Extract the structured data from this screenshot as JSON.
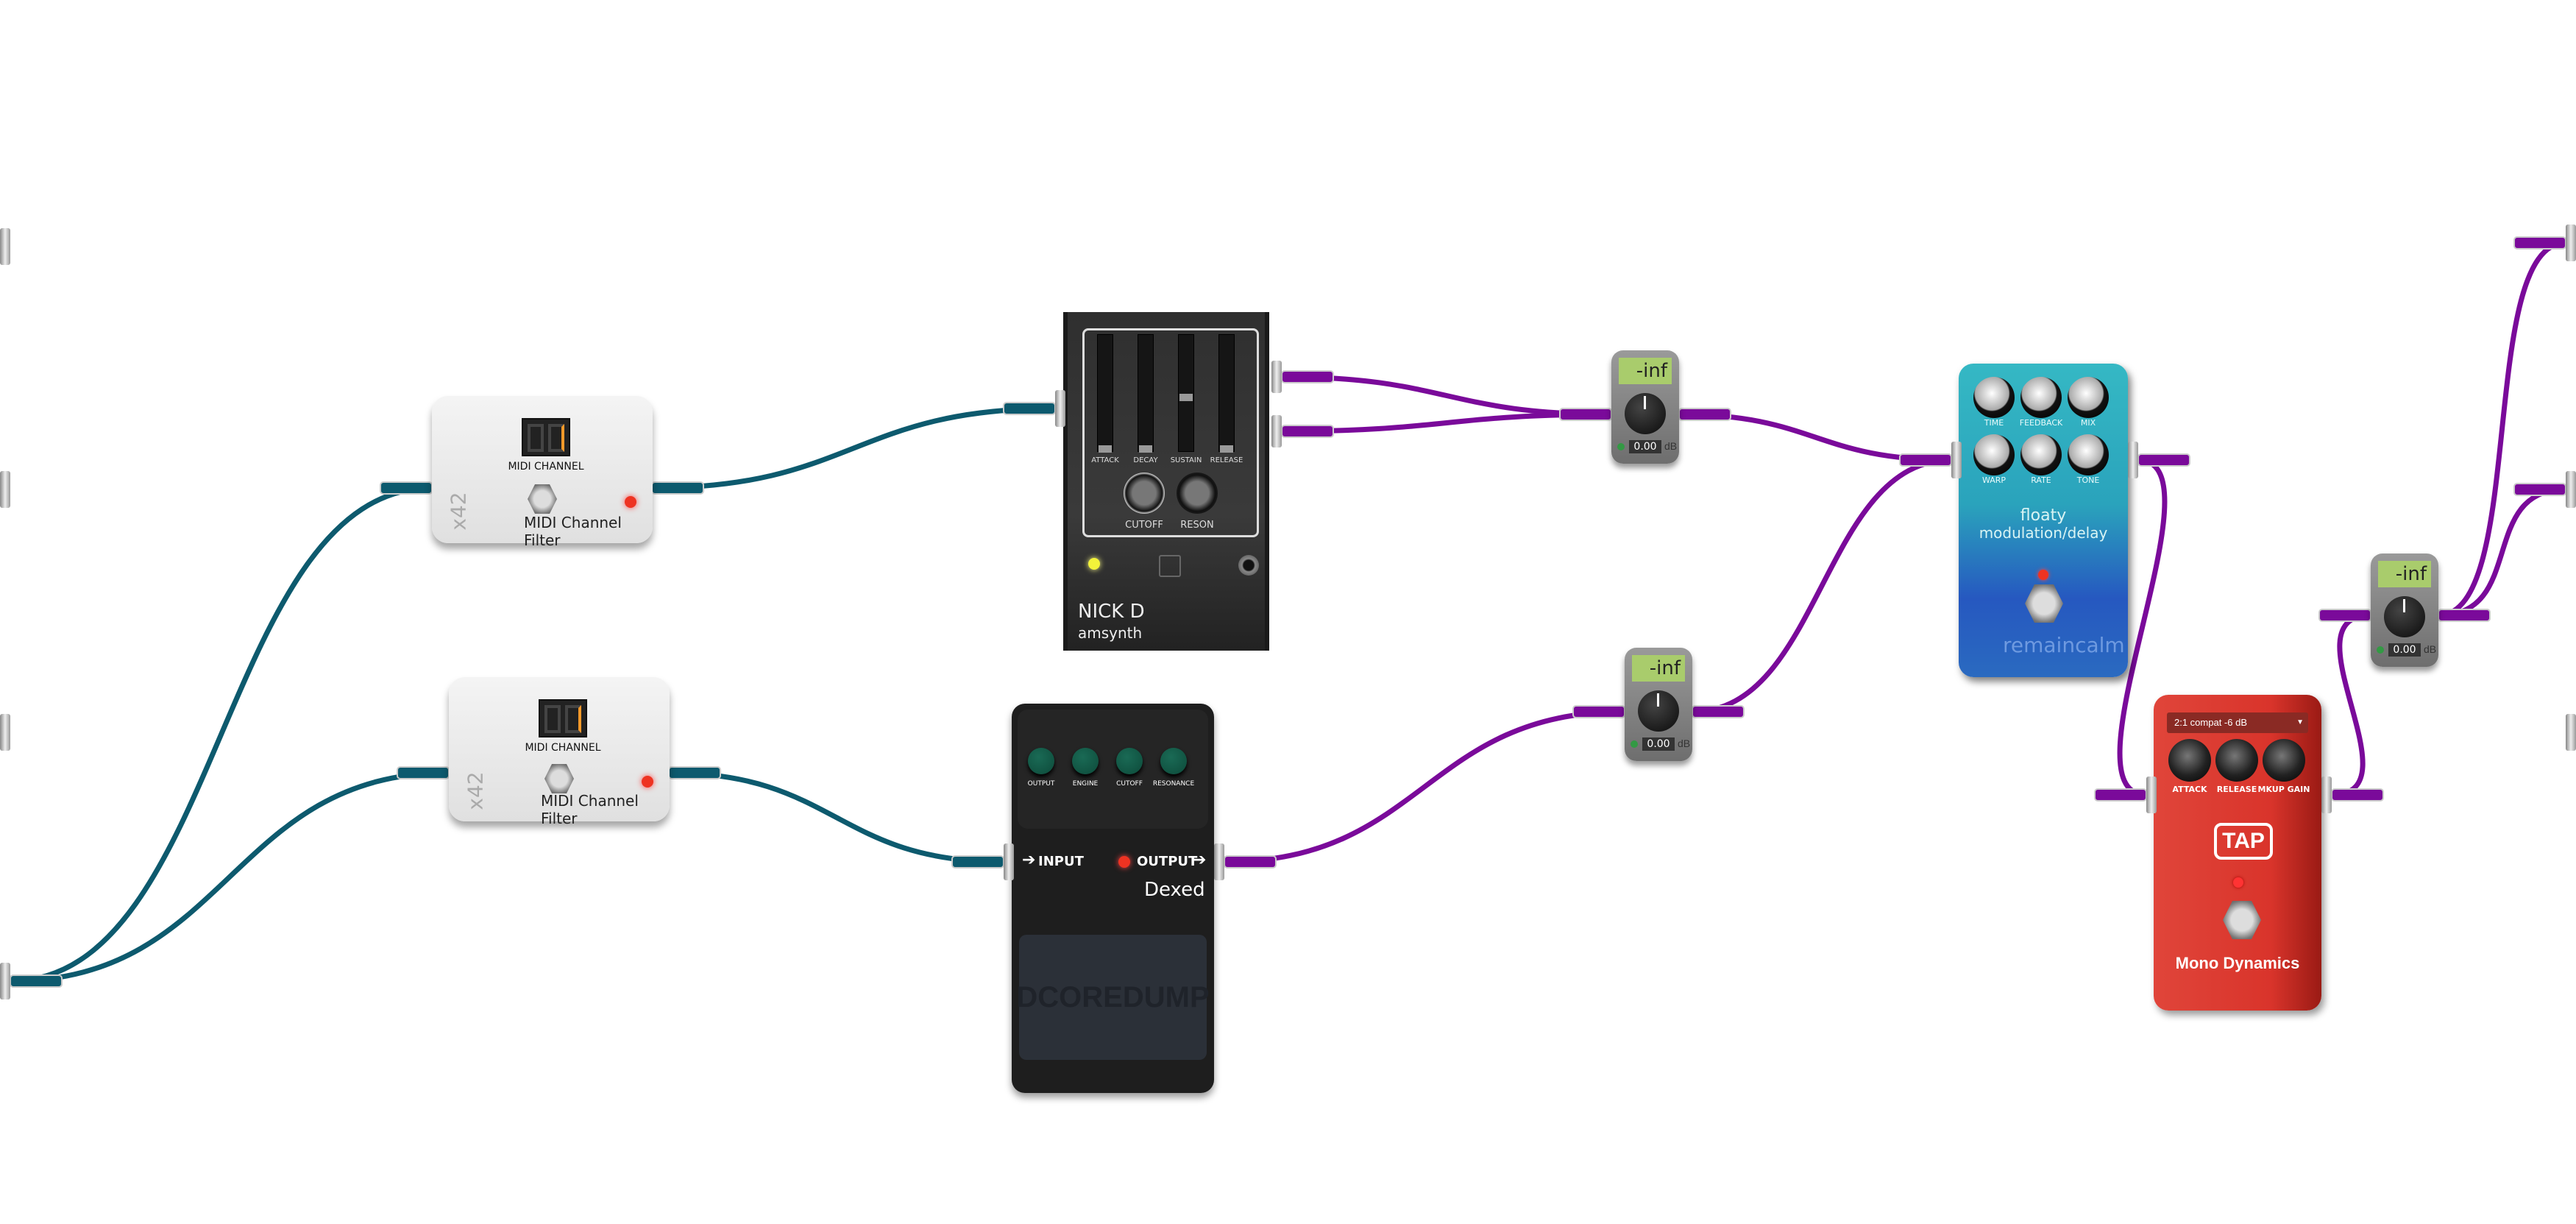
{
  "midi_filters": [
    {
      "brand": "x42",
      "display_label": "MIDI CHANNEL",
      "name": "MIDI Channel Filter",
      "channel_digit": "1"
    },
    {
      "brand": "x42",
      "display_label": "MIDI CHANNEL",
      "name": "MIDI Channel Filter",
      "channel_digit": "1"
    }
  ],
  "amsynth": {
    "brand": "NICK D",
    "name": "amsynth",
    "sliders": [
      "ATTACK",
      "DECAY",
      "SUSTAIN",
      "RELEASE"
    ],
    "knobs": [
      "CUTOFF",
      "RESON"
    ],
    "led_color": "#f2f23a"
  },
  "dexed": {
    "knobs": [
      "OUTPUT",
      "ENGINE",
      "CUTOFF",
      "RESONANCE"
    ],
    "input_label": "INPUT",
    "output_label": "OUTPUT",
    "name": "Dexed",
    "brand": "DCOREDUMP",
    "knob_color": "#0d4a3a"
  },
  "gains": [
    {
      "display": "-inf",
      "value": "0.00",
      "unit": "dB"
    },
    {
      "display": "-inf",
      "value": "0.00",
      "unit": "dB"
    },
    {
      "display": "-inf",
      "value": "0.00",
      "unit": "dB"
    }
  ],
  "floaty": {
    "knobs": [
      "TIME",
      "FEEDBACK",
      "MIX",
      "WARP",
      "RATE",
      "TONE"
    ],
    "name_line1": "floaty",
    "name_line2": "modulation/delay",
    "brand": "remaincalm"
  },
  "tap": {
    "preset": "2:1 compat -6 dB",
    "knobs": [
      "ATTACK",
      "RELEASE",
      "MKUP GAIN"
    ],
    "logo": "TAP",
    "name": "Mono Dynamics",
    "color": "#d9342b"
  },
  "colors": {
    "midi_cable": "#0d5a6e",
    "audio_cable": "#7a0a9a"
  }
}
